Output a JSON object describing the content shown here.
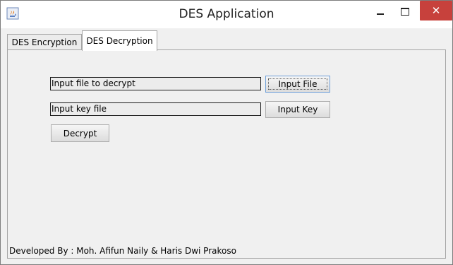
{
  "window": {
    "title": "DES Application",
    "close_symbol": "✕"
  },
  "tabs": [
    {
      "label": "DES Encryption",
      "selected": false
    },
    {
      "label": "DES Decryption",
      "selected": true
    }
  ],
  "decrypt_panel": {
    "input_file_field": "Input file to decrypt",
    "input_file_button": "Input File",
    "input_key_field": "Input key file",
    "input_key_button": "Input Key",
    "decrypt_button": "Decrypt"
  },
  "footer": {
    "credits": "Developed By : Moh. Afifun Naily & Haris Dwi Prakoso"
  },
  "icons": {
    "app": "java-coffee-icon",
    "minimize": "minimize-icon",
    "maximize": "maximize-icon",
    "close": "close-icon"
  },
  "colors": {
    "close_button": "#c7413c",
    "focus_border": "#6f9fd8"
  }
}
